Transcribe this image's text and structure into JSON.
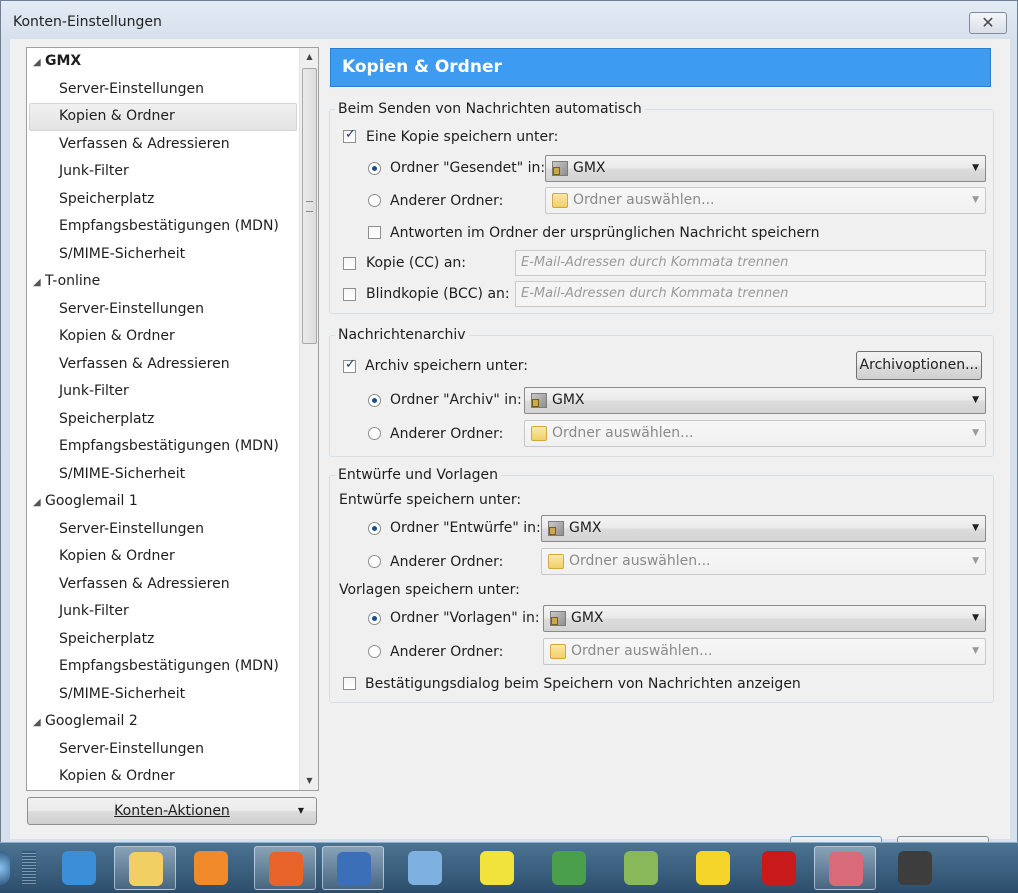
{
  "window": {
    "title": "Konten-Einstellungen",
    "close_glyph": "✕"
  },
  "tree": {
    "rows": [
      {
        "type": "account",
        "label": "GMX",
        "bold": true
      },
      {
        "type": "child",
        "label": "Server-Einstellungen"
      },
      {
        "type": "child",
        "label": "Kopien & Ordner",
        "selected": true
      },
      {
        "type": "child",
        "label": "Verfassen & Adressieren"
      },
      {
        "type": "child",
        "label": "Junk-Filter"
      },
      {
        "type": "child",
        "label": "Speicherplatz"
      },
      {
        "type": "child",
        "label": "Empfangsbestätigungen (MDN)"
      },
      {
        "type": "child",
        "label": "S/MIME-Sicherheit"
      },
      {
        "type": "account",
        "label": "T-online"
      },
      {
        "type": "child",
        "label": "Server-Einstellungen"
      },
      {
        "type": "child",
        "label": "Kopien & Ordner"
      },
      {
        "type": "child",
        "label": "Verfassen & Adressieren"
      },
      {
        "type": "child",
        "label": "Junk-Filter"
      },
      {
        "type": "child",
        "label": "Speicherplatz"
      },
      {
        "type": "child",
        "label": "Empfangsbestätigungen (MDN)"
      },
      {
        "type": "child",
        "label": "S/MIME-Sicherheit"
      },
      {
        "type": "account",
        "label": "Googlemail 1"
      },
      {
        "type": "child",
        "label": "Server-Einstellungen"
      },
      {
        "type": "child",
        "label": "Kopien & Ordner"
      },
      {
        "type": "child",
        "label": "Verfassen & Adressieren"
      },
      {
        "type": "child",
        "label": "Junk-Filter"
      },
      {
        "type": "child",
        "label": "Speicherplatz"
      },
      {
        "type": "child",
        "label": "Empfangsbestätigungen (MDN)"
      },
      {
        "type": "child",
        "label": "S/MIME-Sicherheit"
      },
      {
        "type": "account",
        "label": "Googlemail 2"
      },
      {
        "type": "child",
        "label": "Server-Einstellungen"
      },
      {
        "type": "child",
        "label": "Kopien & Ordner"
      }
    ],
    "expand_glyph": "◢",
    "konten_aktionen": "Konten-Aktionen"
  },
  "panel": {
    "title": "Kopien & Ordner",
    "send_group": {
      "title": "Beim Senden von Nachrichten automatisch",
      "copy_label": "Eine Kopie speichern unter:",
      "copy_checked": true,
      "folder_sent_label": "Ordner \"Gesendet\" in:",
      "folder_sent_value": "GMX",
      "other_folder_label": "Anderer Ordner:",
      "other_folder_placeholder": "Ordner auswählen...",
      "reply_label": "Antworten im Ordner der ursprünglichen Nachricht speichern",
      "cc_label": "Kopie (CC) an:",
      "cc_placeholder": "E-Mail-Adressen durch Kommata trennen",
      "bcc_label": "Blindkopie (BCC) an:",
      "bcc_placeholder": "E-Mail-Adressen durch Kommata trennen"
    },
    "archive_group": {
      "title": "Nachrichtenarchiv",
      "archive_label": "Archiv speichern unter:",
      "archive_checked": true,
      "options_button": "Archivoptionen...",
      "folder_archive_label": "Ordner \"Archiv\" in:",
      "folder_archive_value": "GMX",
      "other_folder_label": "Anderer Ordner:",
      "other_folder_placeholder": "Ordner auswählen..."
    },
    "drafts_group": {
      "title": "Entwürfe und Vorlagen",
      "drafts_heading": "Entwürfe speichern unter:",
      "folder_drafts_label": "Ordner \"Entwürfe\" in:",
      "folder_drafts_value": "GMX",
      "other_folder_label_1": "Anderer Ordner:",
      "other_folder_placeholder_1": "Ordner auswählen...",
      "templates_heading": "Vorlagen speichern unter:",
      "folder_templates_label": "Ordner \"Vorlagen\" in:",
      "folder_templates_value": "GMX",
      "other_folder_label_2": "Anderer Ordner:",
      "other_folder_placeholder_2": "Ordner auswählen...",
      "confirm_label": "Bestätigungsdialog beim Speichern von Nachrichten anzeigen"
    }
  },
  "taskbar": {
    "items": [
      {
        "name": "ie-icon",
        "color": "#3a8fd8"
      },
      {
        "name": "explorer-icon",
        "color": "#f2cf63",
        "active": true
      },
      {
        "name": "media-player-icon",
        "color": "#f08a2a"
      },
      {
        "name": "firefox-icon",
        "color": "#e8632a",
        "active": true
      },
      {
        "name": "thunderbird-icon",
        "color": "#3b6fb8",
        "active": true
      },
      {
        "name": "mail-icon",
        "color": "#7fb1e0"
      },
      {
        "name": "clock-icon",
        "color": "#f1e23c"
      },
      {
        "name": "money-icon",
        "color": "#4aa04a"
      },
      {
        "name": "notepad-icon",
        "color": "#88b85a"
      },
      {
        "name": "moon-icon",
        "color": "#f5d52a"
      },
      {
        "name": "filezilla-icon",
        "color": "#c8191b"
      },
      {
        "name": "scissors-icon",
        "color": "#d96a7a",
        "active": true
      },
      {
        "name": "movie-icon",
        "color": "#3d3d3d"
      }
    ]
  }
}
